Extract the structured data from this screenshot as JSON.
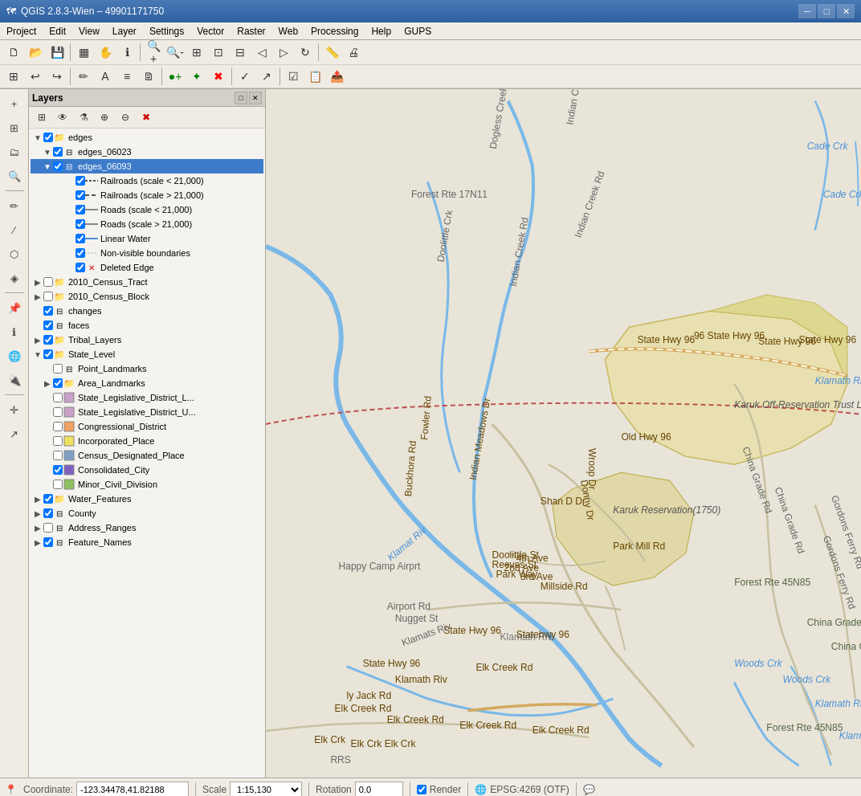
{
  "app": {
    "title": "QGIS 2.8.3-Wien – 49901171750",
    "icon": "🗺"
  },
  "titlebar": {
    "minimize": "─",
    "maximize": "□",
    "close": "✕"
  },
  "menubar": {
    "items": [
      "Project",
      "Edit",
      "View",
      "Layer",
      "Settings",
      "Vector",
      "Raster",
      "Web",
      "Processing",
      "Help",
      "GUPS"
    ]
  },
  "layers_panel": {
    "title": "Layers",
    "tree": [
      {
        "id": "edges",
        "label": "edges",
        "level": 0,
        "expanded": true,
        "checked": true,
        "type": "group"
      },
      {
        "id": "edges_06023",
        "label": "edges_06023",
        "level": 1,
        "expanded": true,
        "checked": true,
        "type": "layer"
      },
      {
        "id": "edges_06093",
        "label": "edges_06093",
        "level": 1,
        "expanded": true,
        "checked": true,
        "type": "layer",
        "selected": true
      },
      {
        "id": "railroads_s21",
        "label": "Railroads (scale < 21,000)",
        "level": 3,
        "checked": true,
        "type": "legend_dashed"
      },
      {
        "id": "railroads_g21",
        "label": "Railroads (scale > 21,000)",
        "level": 3,
        "checked": true,
        "type": "legend_dashed"
      },
      {
        "id": "roads_s21",
        "label": "Roads (scale < 21,000)",
        "level": 3,
        "checked": true,
        "type": "legend_line_dark"
      },
      {
        "id": "roads_g21",
        "label": "Roads (scale > 21,000)",
        "level": 3,
        "checked": true,
        "type": "legend_line_dark"
      },
      {
        "id": "linear_water",
        "label": "Linear Water",
        "level": 3,
        "checked": true,
        "type": "legend_line_blue"
      },
      {
        "id": "non_visible",
        "label": "Non-visible boundaries",
        "level": 3,
        "checked": true,
        "type": "legend_dotted"
      },
      {
        "id": "deleted_edge",
        "label": "Deleted Edge",
        "level": 3,
        "checked": true,
        "type": "legend_x"
      },
      {
        "id": "census_tract",
        "label": "2010_Census_Tract",
        "level": 0,
        "expanded": false,
        "checked": false,
        "type": "group"
      },
      {
        "id": "census_block",
        "label": "2010_Census_Block",
        "level": 0,
        "expanded": false,
        "checked": false,
        "type": "group"
      },
      {
        "id": "changes",
        "label": "changes",
        "level": 0,
        "expanded": false,
        "checked": true,
        "type": "layer"
      },
      {
        "id": "faces",
        "label": "faces",
        "level": 0,
        "expanded": false,
        "checked": true,
        "type": "layer"
      },
      {
        "id": "tribal_layers",
        "label": "Tribal_Layers",
        "level": 0,
        "expanded": false,
        "checked": true,
        "type": "group"
      },
      {
        "id": "state_level",
        "label": "State_Level",
        "level": 0,
        "expanded": true,
        "checked": true,
        "type": "group"
      },
      {
        "id": "point_landmarks",
        "label": "Point_Landmarks",
        "level": 1,
        "checked": false,
        "type": "layer"
      },
      {
        "id": "area_landmarks",
        "label": "Area_Landmarks",
        "level": 1,
        "expanded": false,
        "checked": true,
        "type": "group"
      },
      {
        "id": "state_leg_l",
        "label": "State_Legislative_District_L...",
        "level": 1,
        "checked": false,
        "type": "layer",
        "color": "#c8a0c8"
      },
      {
        "id": "state_leg_u",
        "label": "State_Legislative_District_U...",
        "level": 1,
        "checked": false,
        "type": "layer",
        "color": "#c8a0c8"
      },
      {
        "id": "congressional",
        "label": "Congressional_District",
        "level": 1,
        "checked": false,
        "type": "layer",
        "color": "#f0a060"
      },
      {
        "id": "inc_place",
        "label": "Incorporated_Place",
        "level": 1,
        "checked": false,
        "type": "layer",
        "color": "#f0e060"
      },
      {
        "id": "census_designated",
        "label": "Census_Designated_Place",
        "level": 1,
        "checked": false,
        "type": "layer",
        "color": "#80a0c8"
      },
      {
        "id": "consolidated_city",
        "label": "Consolidated_City",
        "level": 1,
        "checked": true,
        "type": "layer",
        "color": "#8060c0"
      },
      {
        "id": "minor_civil",
        "label": "Minor_Civil_Division",
        "level": 1,
        "checked": false,
        "type": "layer",
        "color": "#90c060"
      },
      {
        "id": "water_features",
        "label": "Water_Features",
        "level": 0,
        "expanded": false,
        "checked": true,
        "type": "group"
      },
      {
        "id": "county",
        "label": "County",
        "level": 0,
        "expanded": false,
        "checked": true,
        "type": "layer"
      },
      {
        "id": "address_ranges",
        "label": "Address_Ranges",
        "level": 0,
        "expanded": false,
        "checked": false,
        "type": "layer"
      },
      {
        "id": "feature_names",
        "label": "Feature_Names",
        "level": 0,
        "expanded": false,
        "checked": true,
        "type": "layer"
      }
    ]
  },
  "statusbar": {
    "coord_label": "Coordinate:",
    "coord_value": "-123.34478,41.82188",
    "scale_label": "Scale",
    "scale_value": "1:15,130",
    "rotation_label": "Rotation",
    "rotation_value": "0.0",
    "render_label": "Render",
    "epsg_label": "EPSG:4269 (OTF)"
  }
}
